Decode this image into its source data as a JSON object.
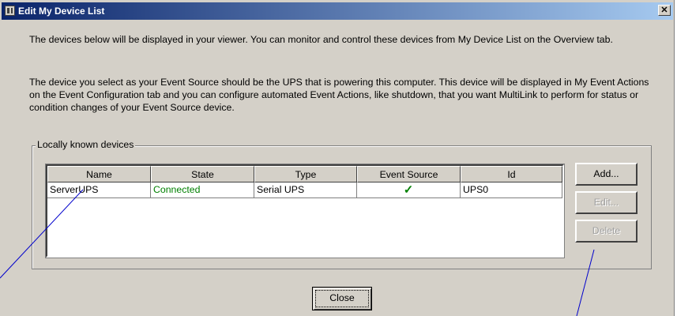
{
  "window": {
    "title": "Edit My Device List",
    "icons": {
      "app": "multilink-app-icon",
      "close": "close-x-icon"
    }
  },
  "intro": {
    "paragraph1": "The devices below will be displayed in your viewer. You can monitor and control these devices from My Device List on the Overview tab.",
    "paragraph2": "The device you select as your Event Source should be the UPS that is powering this computer. This device will be displayed in My Event Actions on the Event Configuration tab and you can configure automated Event Actions, like shutdown, that you want MultiLink to perform for status or condition changes of your Event Source device."
  },
  "devices": {
    "group_label": "Locally known devices",
    "columns": [
      "Name",
      "State",
      "Type",
      "Event Source",
      "Id"
    ],
    "rows": [
      {
        "name": "ServerUPS",
        "state": "Connected",
        "type": "Serial UPS",
        "event_source": "✓",
        "id": "UPS0"
      }
    ],
    "buttons": {
      "add": "Add...",
      "edit": "Edit...",
      "delete": "Delete"
    },
    "colors": {
      "connected": "#008000",
      "checkmark": "#008000"
    }
  },
  "footer": {
    "close_label": "Close"
  },
  "colors": {
    "titlebar_start": "#0a246a",
    "titlebar_end": "#a6caf0",
    "dialog_bg": "#d4d0c8",
    "callout_line": "#0000cc"
  }
}
